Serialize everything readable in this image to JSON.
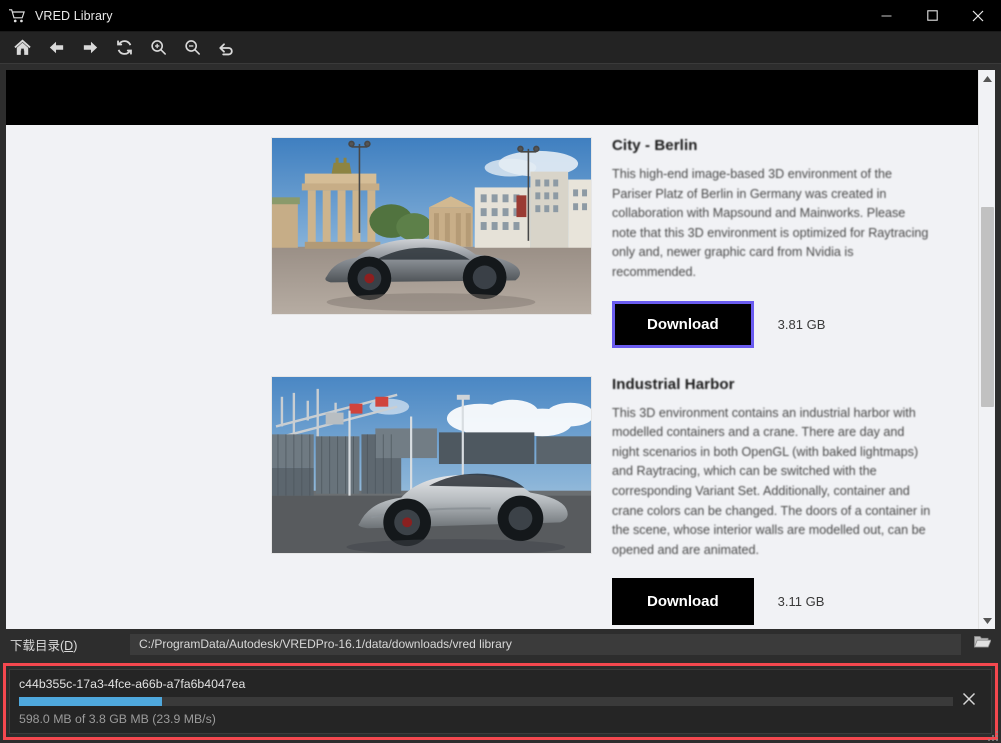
{
  "window": {
    "title": "VRED Library",
    "app_icon": "shopping-cart-icon",
    "controls": {
      "minimize": "—",
      "maximize": "□",
      "close": "✕"
    }
  },
  "toolbar": {
    "buttons": [
      {
        "name": "home",
        "icon": "home-icon",
        "label": "Home"
      },
      {
        "name": "back",
        "icon": "arrow-left-icon",
        "label": "Back"
      },
      {
        "name": "forward",
        "icon": "arrow-right-icon",
        "label": "Forward"
      },
      {
        "name": "reload",
        "icon": "refresh-icon",
        "label": "Reload"
      },
      {
        "name": "zoom-in",
        "icon": "magnifier-plus-icon",
        "label": "Zoom In"
      },
      {
        "name": "zoom-out",
        "icon": "magnifier-minus-icon",
        "label": "Zoom Out"
      },
      {
        "name": "reset",
        "icon": "undo-arrow-icon",
        "label": "Reset"
      }
    ]
  },
  "library": {
    "items": [
      {
        "title": "City - Berlin",
        "description": "This high-end image-based 3D environment of the Pariser Platz of Berlin in Germany was created in collaboration with Mapsound and Mainworks. Please note that this 3D environment is optimized for Raytracing only and, newer graphic card from Nvidia is recommended.",
        "download_label": "Download",
        "size": "3.81 GB",
        "focused": true,
        "thumbnail": "berlin-brandenburg-gate-car-render"
      },
      {
        "title": "Industrial Harbor",
        "description": "This 3D environment contains an industrial harbor with modelled containers and a crane. There are day and night scenarios in both OpenGL (with baked lightmaps) and Raytracing, which can be switched with the corresponding Variant Set. Additionally, container and crane colors can be changed. The doors of a container in the scene, whose interior walls are modelled out, can be opened and are animated.",
        "download_label": "Download",
        "size": "3.11 GB",
        "focused": false,
        "thumbnail": "industrial-harbor-car-render"
      }
    ]
  },
  "path_row": {
    "label_prefix": "下载目录(",
    "label_accel": "D",
    "label_suffix": ")",
    "value": "C:/ProgramData/Autodesk/VREDPro-16.1/data/downloads/vred library",
    "browse_icon": "open-folder-icon"
  },
  "download_panel": {
    "highlight_color": "#f4484f",
    "item": {
      "filename": "c44b355c-17a3-4fce-a66b-a7fa6b4047ea",
      "progress_percent": 15.3,
      "progress_color": "#4fa8dd",
      "status": "598.0 MB of 3.8 GB MB (23.9 MB/s)",
      "cancel_icon": "close-x-icon"
    }
  }
}
